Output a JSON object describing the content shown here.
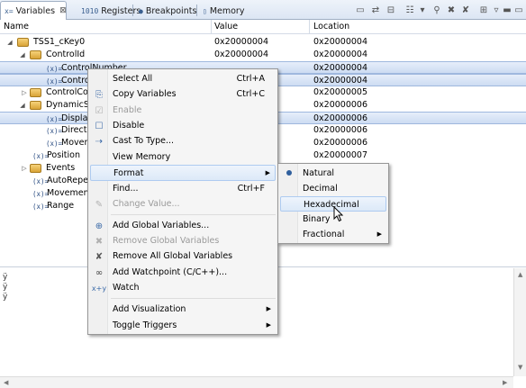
{
  "tabs": [
    {
      "label": "Variables",
      "icon": "x=",
      "active": true,
      "close": "⊠"
    },
    {
      "label": "Registers",
      "icon": "1010",
      "active": false
    },
    {
      "label": "Breakpoints",
      "icon": "●",
      "active": false
    },
    {
      "label": "Memory",
      "icon": "▯",
      "active": false
    }
  ],
  "columns": {
    "name": "Name",
    "value": "Value",
    "location": "Location"
  },
  "rows": [
    {
      "name": "TSS1_cKey0",
      "value": "0x20000004",
      "location": "0x20000004"
    },
    {
      "name": "ControlId",
      "value": "0x20000004",
      "location": "0x20000004"
    },
    {
      "name": "ControlNumber",
      "value": "",
      "location": "0x20000004"
    },
    {
      "name": "Control",
      "value": "",
      "location": "0x20000004"
    },
    {
      "name": "ControlCor",
      "value": "",
      "location": "0x20000005"
    },
    {
      "name": "DynamicSt",
      "value": "",
      "location": "0x20000006"
    },
    {
      "name": "Displac",
      "value": "",
      "location": "0x20000006"
    },
    {
      "name": "Directic",
      "value": "",
      "location": "0x20000006"
    },
    {
      "name": "Movem",
      "value": "",
      "location": "0x20000006"
    },
    {
      "name": "Position",
      "value": "",
      "location": "0x20000007"
    },
    {
      "name": "Events",
      "value": "",
      "location": ""
    },
    {
      "name": "AutoRepea",
      "value": "",
      "location": ""
    },
    {
      "name": "Movement",
      "value": "",
      "location": ""
    },
    {
      "name": "Range",
      "value": "",
      "location": ""
    }
  ],
  "detail_lines": [
    "ÿ",
    "ÿ",
    "ÿ"
  ],
  "menu": {
    "select_all": "Select All",
    "select_all_short": "Ctrl+A",
    "copy_variables": "Copy Variables",
    "copy_variables_short": "Ctrl+C",
    "enable": "Enable",
    "disable": "Disable",
    "cast_to_type": "Cast To Type...",
    "view_memory": "View Memory",
    "format": "Format",
    "find": "Find...",
    "find_short": "Ctrl+F",
    "change_value": "Change Value...",
    "add_global_variables": "Add Global Variables...",
    "remove_global_variables": "Remove Global Variables",
    "remove_all_global_variables": "Remove All Global Variables",
    "add_watchpoint": "Add Watchpoint (C/C++)...",
    "watch": "Watch",
    "add_visualization": "Add Visualization",
    "toggle_triggers": "Toggle Triggers"
  },
  "format_submenu": {
    "natural": "Natural",
    "decimal": "Decimal",
    "hexadecimal": "Hexadecimal",
    "binary": "Binary",
    "fractional": "Fractional",
    "selected": "Natural",
    "highlighted": "Hexadecimal"
  },
  "icon_names": {
    "struct": "struct-icon",
    "variable": "variable-icon"
  }
}
